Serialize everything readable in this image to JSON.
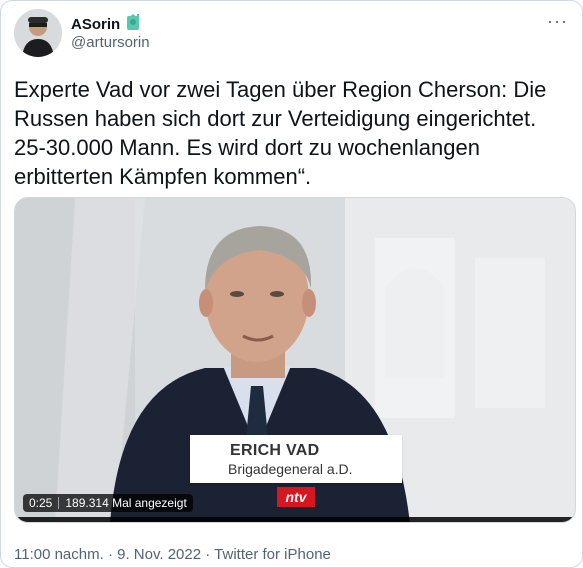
{
  "user": {
    "display_name": "ASorin",
    "handle": "@artursorin",
    "badge_icon": "statue-of-liberty-emoji"
  },
  "tweet": {
    "text": "Experte Vad vor zwei Tagen über Region Cherson: Die Russen haben sich dort zur Verteidigung eingerichtet. 25-30.000 Mann. Es wird dort zu wochenlangen erbitterten Kämpfen kommen“."
  },
  "video": {
    "lower_third_name": "ERICH VAD",
    "lower_third_role": "Brigadegeneral a.D.",
    "channel_logo": "ntv",
    "timestamp": "0:25",
    "views": "189.314 Mal angezeigt"
  },
  "footer": {
    "time": "11:00 nachm.",
    "date": "9. Nov. 2022",
    "source": "Twitter for iPhone",
    "separator": "·"
  },
  "colors": {
    "text_primary": "#0f1419",
    "text_secondary": "#536471",
    "ntv_red": "#d7171f"
  }
}
